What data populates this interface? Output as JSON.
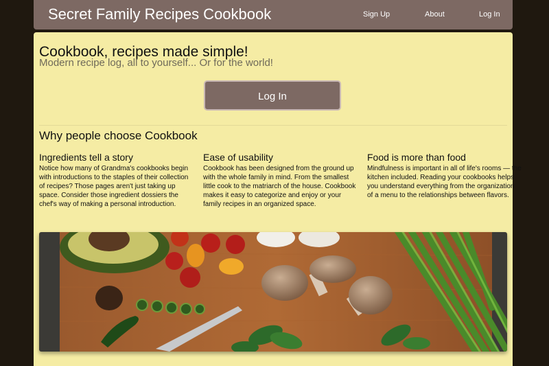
{
  "navbar": {
    "brand": "Secret Family Recipes Cookbook",
    "links": [
      "Sign Up",
      "About",
      "Log In"
    ]
  },
  "hero": {
    "title": "Cookbook, recipes made simple!",
    "subtitle": "Modern recipe log, all to yourself... Or for the world!",
    "button_label": "Log In"
  },
  "why": {
    "heading": "Why people choose Cookbook",
    "features": [
      {
        "title": "Ingredients tell a story",
        "body": "Notice how many of Grandma's cookbooks begin with introductions to the staples of their collection of recipes? Those pages aren't just taking up space. Consider those ingredient dossiers the chef's way of making a personal introduction."
      },
      {
        "title": "Ease of usability",
        "body": "Cookbook has been designed from the ground up with the whole family in mind. From the smallest little cook to the matriarch of the house. Cookbook makes it easy to categorize and enjoy or your family recipes in an organized space."
      },
      {
        "title": "Food is more than food",
        "body": "Mindfulness is important in all of life's rooms — the kitchen included. Reading your cookbooks helps you understand everything from the organization of a menu to the relationships between flavors."
      }
    ]
  },
  "colors": {
    "navbar": "#7d6963",
    "content_bg": "#f5eca4",
    "page_bg": "#1f180f",
    "button": "#7d6963"
  }
}
